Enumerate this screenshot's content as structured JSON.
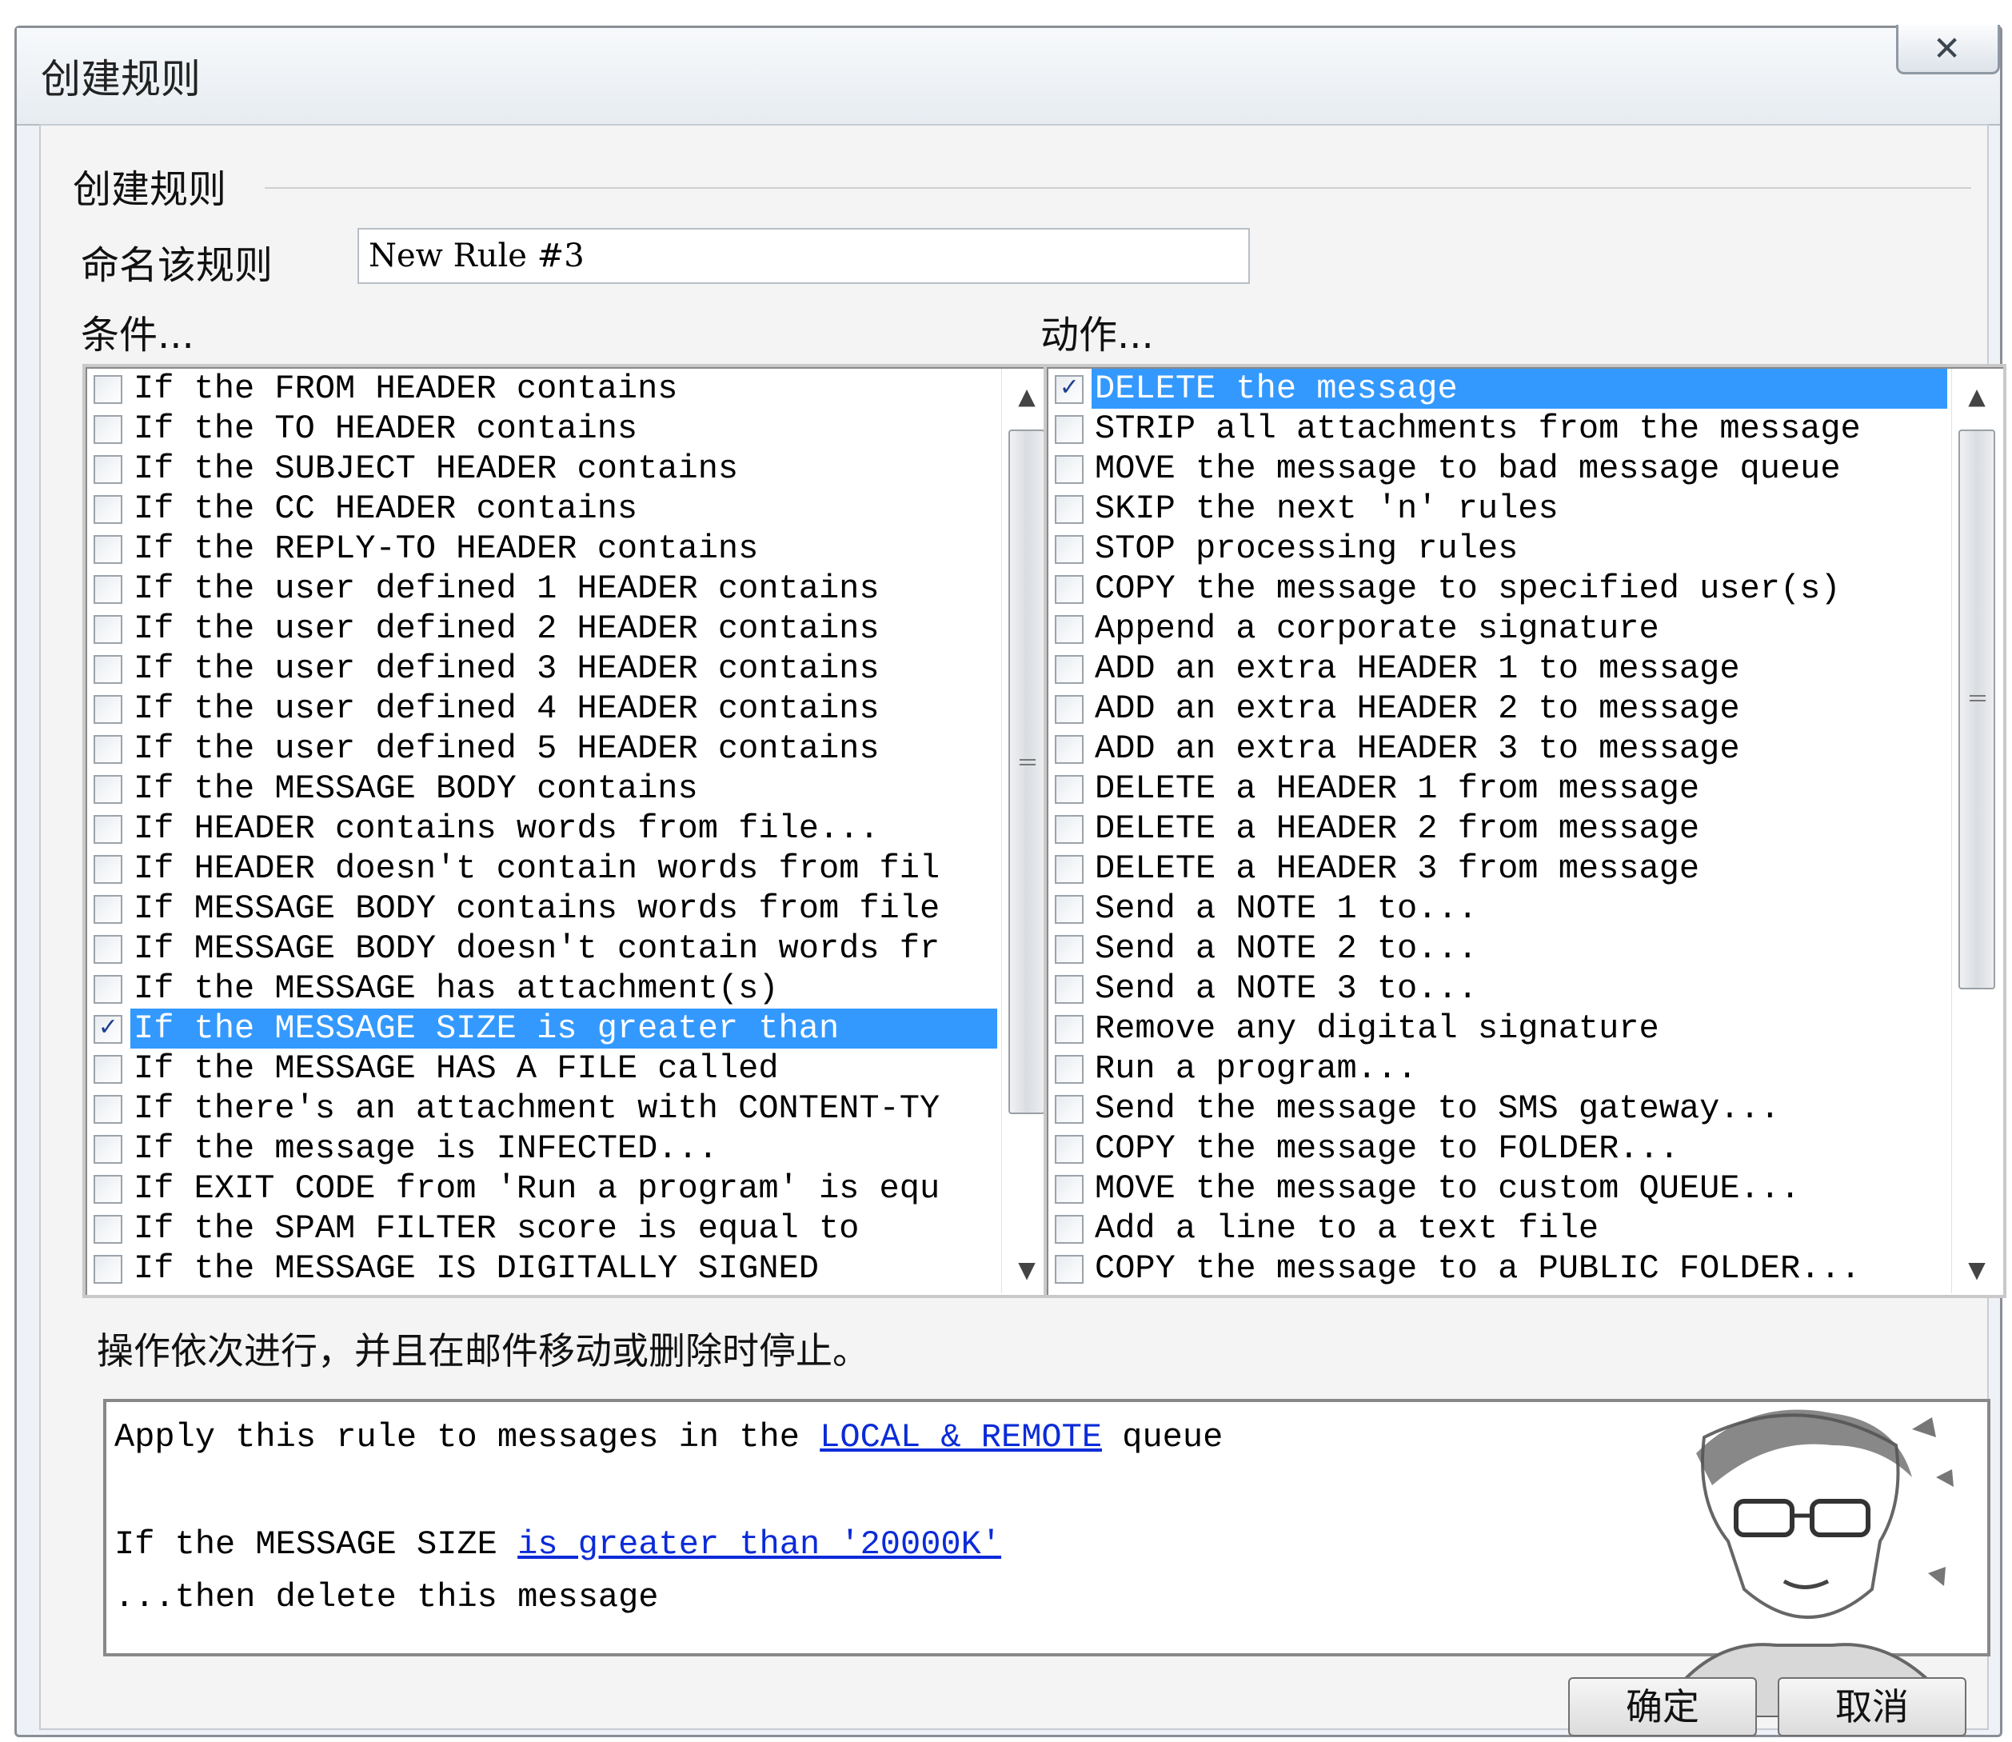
{
  "window": {
    "title": "创建规则",
    "close_glyph": "✕"
  },
  "group": {
    "label": "创建规则"
  },
  "name_field": {
    "label": "命名该规则",
    "value": "New Rule #3"
  },
  "conditions": {
    "label": "条件...",
    "items": [
      {
        "label": "If the FROM HEADER contains",
        "checked": false,
        "selected": false
      },
      {
        "label": "If the TO HEADER contains",
        "checked": false,
        "selected": false
      },
      {
        "label": "If the SUBJECT HEADER contains",
        "checked": false,
        "selected": false
      },
      {
        "label": "If the CC HEADER contains",
        "checked": false,
        "selected": false
      },
      {
        "label": "If the REPLY-TO HEADER contains",
        "checked": false,
        "selected": false
      },
      {
        "label": "If the user defined 1 HEADER contains",
        "checked": false,
        "selected": false
      },
      {
        "label": "If the user defined 2 HEADER contains",
        "checked": false,
        "selected": false
      },
      {
        "label": "If the user defined 3 HEADER contains",
        "checked": false,
        "selected": false
      },
      {
        "label": "If the user defined 4 HEADER contains",
        "checked": false,
        "selected": false
      },
      {
        "label": "If the user defined 5 HEADER contains",
        "checked": false,
        "selected": false
      },
      {
        "label": "If the MESSAGE BODY contains",
        "checked": false,
        "selected": false
      },
      {
        "label": "If HEADER contains words from file...",
        "checked": false,
        "selected": false
      },
      {
        "label": "If HEADER doesn't contain words from fil",
        "checked": false,
        "selected": false
      },
      {
        "label": "If MESSAGE BODY contains words from file",
        "checked": false,
        "selected": false
      },
      {
        "label": "If MESSAGE BODY doesn't contain words fr",
        "checked": false,
        "selected": false
      },
      {
        "label": "If the MESSAGE has attachment(s)",
        "checked": false,
        "selected": false
      },
      {
        "label": "If the MESSAGE SIZE is greater than",
        "checked": true,
        "selected": true
      },
      {
        "label": "If the MESSAGE HAS A FILE called",
        "checked": false,
        "selected": false
      },
      {
        "label": "If there's an attachment with CONTENT-TY",
        "checked": false,
        "selected": false
      },
      {
        "label": "If the message is INFECTED...",
        "checked": false,
        "selected": false
      },
      {
        "label": "If EXIT CODE from 'Run a program' is equ",
        "checked": false,
        "selected": false
      },
      {
        "label": "If the SPAM FILTER score is equal to",
        "checked": false,
        "selected": false
      },
      {
        "label": "If the MESSAGE IS DIGITALLY SIGNED",
        "checked": false,
        "selected": false
      }
    ]
  },
  "actions": {
    "label": "动作...",
    "items": [
      {
        "label": "DELETE the message",
        "checked": true,
        "selected": true
      },
      {
        "label": "STRIP all attachments from the message",
        "checked": false,
        "selected": false
      },
      {
        "label": "MOVE the message to bad message queue",
        "checked": false,
        "selected": false
      },
      {
        "label": "SKIP the next 'n' rules",
        "checked": false,
        "selected": false
      },
      {
        "label": "STOP processing rules",
        "checked": false,
        "selected": false
      },
      {
        "label": "COPY the message to specified user(s)",
        "checked": false,
        "selected": false
      },
      {
        "label": "Append a corporate signature",
        "checked": false,
        "selected": false
      },
      {
        "label": "ADD an extra HEADER 1 to message",
        "checked": false,
        "selected": false
      },
      {
        "label": "ADD an extra HEADER 2 to message",
        "checked": false,
        "selected": false
      },
      {
        "label": "ADD an extra HEADER 3 to message",
        "checked": false,
        "selected": false
      },
      {
        "label": "DELETE a HEADER 1 from message",
        "checked": false,
        "selected": false
      },
      {
        "label": "DELETE a HEADER 2 from message",
        "checked": false,
        "selected": false
      },
      {
        "label": "DELETE a HEADER 3 from message",
        "checked": false,
        "selected": false
      },
      {
        "label": "Send a NOTE 1 to...",
        "checked": false,
        "selected": false
      },
      {
        "label": "Send a NOTE 2 to...",
        "checked": false,
        "selected": false
      },
      {
        "label": "Send a NOTE 3 to...",
        "checked": false,
        "selected": false
      },
      {
        "label": "Remove any digital signature",
        "checked": false,
        "selected": false
      },
      {
        "label": "Run a program...",
        "checked": false,
        "selected": false
      },
      {
        "label": "Send the message to SMS gateway...",
        "checked": false,
        "selected": false
      },
      {
        "label": "COPY the message to FOLDER...",
        "checked": false,
        "selected": false
      },
      {
        "label": "MOVE the message to custom QUEUE...",
        "checked": false,
        "selected": false
      },
      {
        "label": "Add a line to a text file",
        "checked": false,
        "selected": false
      },
      {
        "label": "COPY the message to a PUBLIC FOLDER...",
        "checked": false,
        "selected": false
      }
    ]
  },
  "note": "操作依次进行，并且在邮件移动或删除时停止。",
  "description": {
    "line1_prefix": "Apply this rule to messages in the",
    "line1_link": "LOCAL & REMOTE",
    "line1_suffix": "queue",
    "line2_prefix": "If the MESSAGE SIZE",
    "line2_link": "is greater than '20000K'",
    "line3": "...then delete this message"
  },
  "buttons": {
    "ok": "确定",
    "cancel": "取消"
  },
  "colors": {
    "selection": "#3399ff",
    "link": "#0b2bd8"
  }
}
